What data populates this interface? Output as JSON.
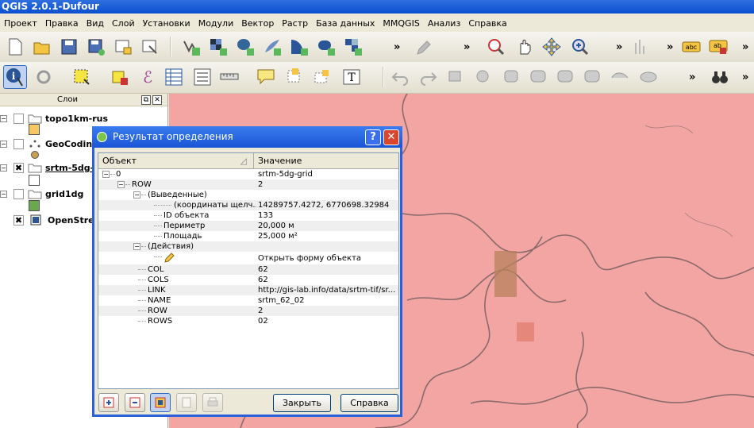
{
  "app": {
    "title": "QGIS 2.0.1-Dufour"
  },
  "menu": [
    "Проект",
    "Правка",
    "Вид",
    "Слой",
    "Установки",
    "Модули",
    "Вектор",
    "Растр",
    "База данных",
    "MMQGIS",
    "Анализ",
    "Справка"
  ],
  "toolbar": {
    "more": "»"
  },
  "colors": {
    "map_bg": "#f2a5a2",
    "river": "#8a6a6a",
    "accent": "#2a60d8"
  },
  "layers_panel": {
    "title": "Слои",
    "float_btn": "⧉",
    "close_btn": "✕",
    "layers": [
      {
        "name": "topo1km-rus",
        "checked": false,
        "swatch": "#f6c85f"
      },
      {
        "name": "GeoCoding",
        "checked": false,
        "swatch": "#c8a050"
      },
      {
        "name": "srtm-5dg-g",
        "checked": true,
        "swatch": "#ffffff"
      },
      {
        "name": "grid1dg",
        "checked": false,
        "swatch": "#6aa84f"
      },
      {
        "name": "OpenStree",
        "checked": true,
        "swatch": ""
      }
    ]
  },
  "dialog": {
    "title": "Результат определения",
    "help": "?",
    "close": "✕",
    "col_object": "Объект",
    "col_value": "Значение",
    "rows": [
      {
        "name": "0",
        "value": "srtm-5dg-grid"
      },
      {
        "name": "ROW",
        "value": "2"
      },
      {
        "name": "(Выведенные)",
        "value": ""
      },
      {
        "name": "(координаты щелч...",
        "value": "14289757.4272, 6770698.32984"
      },
      {
        "name": "ID объекта",
        "value": "133"
      },
      {
        "name": "Периметр",
        "value": "20,000 м"
      },
      {
        "name": "Площадь",
        "value": "25,000 м²"
      },
      {
        "name": "(Действия)",
        "value": ""
      },
      {
        "name": "",
        "value": "Открыть форму объекта"
      },
      {
        "name": "COL",
        "value": "62"
      },
      {
        "name": "COLS",
        "value": "62"
      },
      {
        "name": "LINK",
        "value": "http://gis-lab.info/data/srtm-tif/sr..."
      },
      {
        "name": "NAME",
        "value": "srtm_62_02"
      },
      {
        "name": "ROW",
        "value": "2"
      },
      {
        "name": "ROWS",
        "value": "02"
      }
    ],
    "close_button": "Закрыть",
    "help_button": "Справка"
  }
}
